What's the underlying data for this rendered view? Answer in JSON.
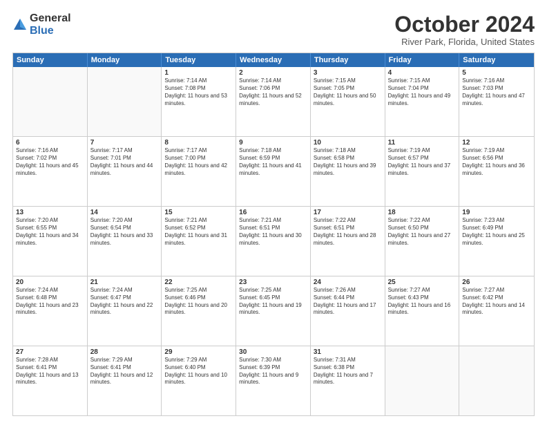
{
  "logo": {
    "general": "General",
    "blue": "Blue"
  },
  "title": "October 2024",
  "subtitle": "River Park, Florida, United States",
  "header_days": [
    "Sunday",
    "Monday",
    "Tuesday",
    "Wednesday",
    "Thursday",
    "Friday",
    "Saturday"
  ],
  "rows": [
    [
      {
        "day": "",
        "info": ""
      },
      {
        "day": "",
        "info": ""
      },
      {
        "day": "1",
        "info": "Sunrise: 7:14 AM\nSunset: 7:08 PM\nDaylight: 11 hours and 53 minutes."
      },
      {
        "day": "2",
        "info": "Sunrise: 7:14 AM\nSunset: 7:06 PM\nDaylight: 11 hours and 52 minutes."
      },
      {
        "day": "3",
        "info": "Sunrise: 7:15 AM\nSunset: 7:05 PM\nDaylight: 11 hours and 50 minutes."
      },
      {
        "day": "4",
        "info": "Sunrise: 7:15 AM\nSunset: 7:04 PM\nDaylight: 11 hours and 49 minutes."
      },
      {
        "day": "5",
        "info": "Sunrise: 7:16 AM\nSunset: 7:03 PM\nDaylight: 11 hours and 47 minutes."
      }
    ],
    [
      {
        "day": "6",
        "info": "Sunrise: 7:16 AM\nSunset: 7:02 PM\nDaylight: 11 hours and 45 minutes."
      },
      {
        "day": "7",
        "info": "Sunrise: 7:17 AM\nSunset: 7:01 PM\nDaylight: 11 hours and 44 minutes."
      },
      {
        "day": "8",
        "info": "Sunrise: 7:17 AM\nSunset: 7:00 PM\nDaylight: 11 hours and 42 minutes."
      },
      {
        "day": "9",
        "info": "Sunrise: 7:18 AM\nSunset: 6:59 PM\nDaylight: 11 hours and 41 minutes."
      },
      {
        "day": "10",
        "info": "Sunrise: 7:18 AM\nSunset: 6:58 PM\nDaylight: 11 hours and 39 minutes."
      },
      {
        "day": "11",
        "info": "Sunrise: 7:19 AM\nSunset: 6:57 PM\nDaylight: 11 hours and 37 minutes."
      },
      {
        "day": "12",
        "info": "Sunrise: 7:19 AM\nSunset: 6:56 PM\nDaylight: 11 hours and 36 minutes."
      }
    ],
    [
      {
        "day": "13",
        "info": "Sunrise: 7:20 AM\nSunset: 6:55 PM\nDaylight: 11 hours and 34 minutes."
      },
      {
        "day": "14",
        "info": "Sunrise: 7:20 AM\nSunset: 6:54 PM\nDaylight: 11 hours and 33 minutes."
      },
      {
        "day": "15",
        "info": "Sunrise: 7:21 AM\nSunset: 6:52 PM\nDaylight: 11 hours and 31 minutes."
      },
      {
        "day": "16",
        "info": "Sunrise: 7:21 AM\nSunset: 6:51 PM\nDaylight: 11 hours and 30 minutes."
      },
      {
        "day": "17",
        "info": "Sunrise: 7:22 AM\nSunset: 6:51 PM\nDaylight: 11 hours and 28 minutes."
      },
      {
        "day": "18",
        "info": "Sunrise: 7:22 AM\nSunset: 6:50 PM\nDaylight: 11 hours and 27 minutes."
      },
      {
        "day": "19",
        "info": "Sunrise: 7:23 AM\nSunset: 6:49 PM\nDaylight: 11 hours and 25 minutes."
      }
    ],
    [
      {
        "day": "20",
        "info": "Sunrise: 7:24 AM\nSunset: 6:48 PM\nDaylight: 11 hours and 23 minutes."
      },
      {
        "day": "21",
        "info": "Sunrise: 7:24 AM\nSunset: 6:47 PM\nDaylight: 11 hours and 22 minutes."
      },
      {
        "day": "22",
        "info": "Sunrise: 7:25 AM\nSunset: 6:46 PM\nDaylight: 11 hours and 20 minutes."
      },
      {
        "day": "23",
        "info": "Sunrise: 7:25 AM\nSunset: 6:45 PM\nDaylight: 11 hours and 19 minutes."
      },
      {
        "day": "24",
        "info": "Sunrise: 7:26 AM\nSunset: 6:44 PM\nDaylight: 11 hours and 17 minutes."
      },
      {
        "day": "25",
        "info": "Sunrise: 7:27 AM\nSunset: 6:43 PM\nDaylight: 11 hours and 16 minutes."
      },
      {
        "day": "26",
        "info": "Sunrise: 7:27 AM\nSunset: 6:42 PM\nDaylight: 11 hours and 14 minutes."
      }
    ],
    [
      {
        "day": "27",
        "info": "Sunrise: 7:28 AM\nSunset: 6:41 PM\nDaylight: 11 hours and 13 minutes."
      },
      {
        "day": "28",
        "info": "Sunrise: 7:29 AM\nSunset: 6:41 PM\nDaylight: 11 hours and 12 minutes."
      },
      {
        "day": "29",
        "info": "Sunrise: 7:29 AM\nSunset: 6:40 PM\nDaylight: 11 hours and 10 minutes."
      },
      {
        "day": "30",
        "info": "Sunrise: 7:30 AM\nSunset: 6:39 PM\nDaylight: 11 hours and 9 minutes."
      },
      {
        "day": "31",
        "info": "Sunrise: 7:31 AM\nSunset: 6:38 PM\nDaylight: 11 hours and 7 minutes."
      },
      {
        "day": "",
        "info": ""
      },
      {
        "day": "",
        "info": ""
      }
    ]
  ]
}
